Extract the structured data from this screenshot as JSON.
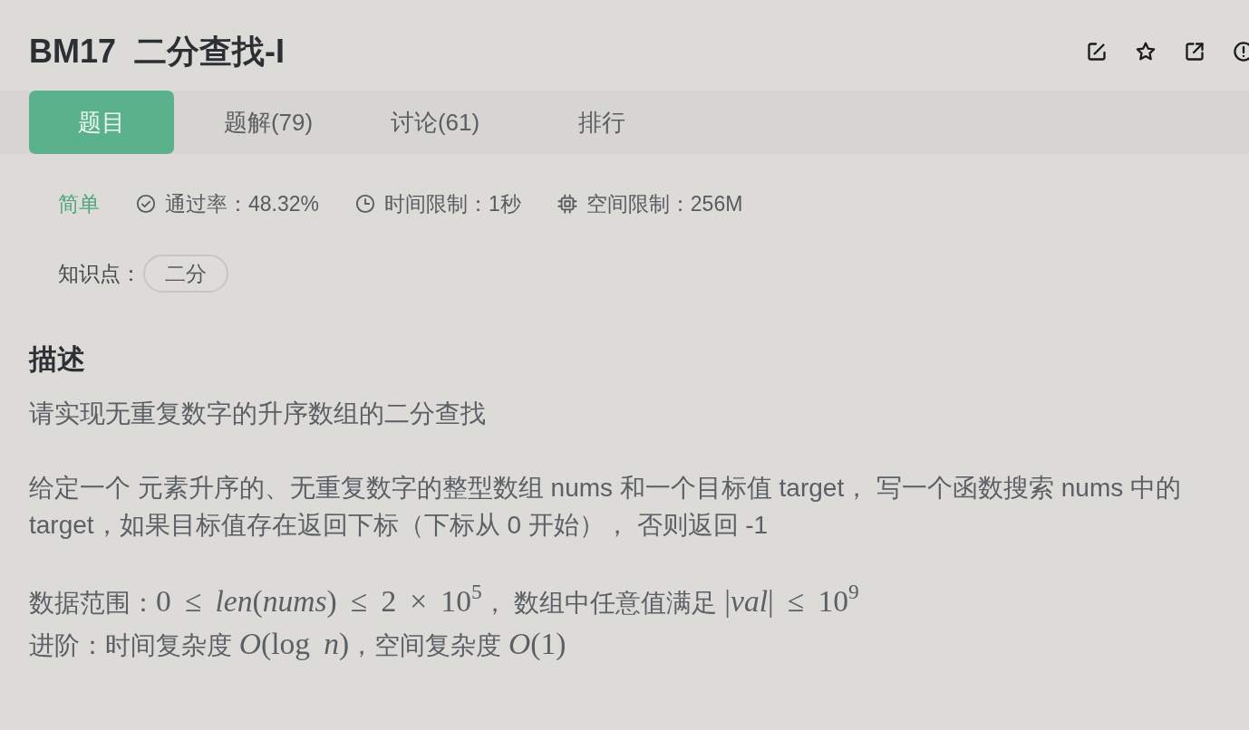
{
  "header": {
    "code": "BM17",
    "title": "二分查找-I"
  },
  "tabs": [
    {
      "label": "题目",
      "selected": true
    },
    {
      "label": "题解(79)",
      "selected": false
    },
    {
      "label": "讨论(61)",
      "selected": false
    },
    {
      "label": "排行",
      "selected": false
    }
  ],
  "meta": {
    "difficulty": "简单",
    "stats": [
      {
        "kind": "pass_rate",
        "text": "通过率：48.32%"
      },
      {
        "kind": "time_limit",
        "text": "时间限制：1秒"
      },
      {
        "kind": "memory_limit",
        "text": "空间限制：256M"
      }
    ]
  },
  "knowledge": {
    "label": "知识点：",
    "tags": [
      "二分"
    ]
  },
  "description": {
    "heading": "描述",
    "paragraphs": [
      [
        [
          {
            "kind": "text",
            "text": "请实现无重复数字的升序数组的二分查找"
          }
        ]
      ],
      [
        [
          {
            "kind": "text",
            "text": "给定一个 元素升序的、无重复数字的整型数组 nums 和一个目标值 target， 写一个函数搜索 nums 中的 target，如果目标值存在返回下标（下标从 0 开始）， 否则返回 -1"
          }
        ]
      ],
      [
        [
          {
            "kind": "text",
            "text": "数据范围："
          },
          {
            "kind": "math",
            "text": "0 ≤ *len*(*nums*) ≤ 2 × 10$^{5}$"
          },
          {
            "kind": "text",
            "text": "， 数组中任意值满足 "
          },
          {
            "kind": "math",
            "text": "|*val*| ≤ 10$^{9}$"
          }
        ],
        [
          {
            "kind": "text",
            "text": "进阶：时间复杂度 "
          },
          {
            "kind": "math",
            "text": "*O*(log *n*)"
          },
          {
            "kind": "text",
            "text": "，空间复杂度 "
          },
          {
            "kind": "math",
            "text": "*O*(1)"
          }
        ]
      ]
    ]
  }
}
